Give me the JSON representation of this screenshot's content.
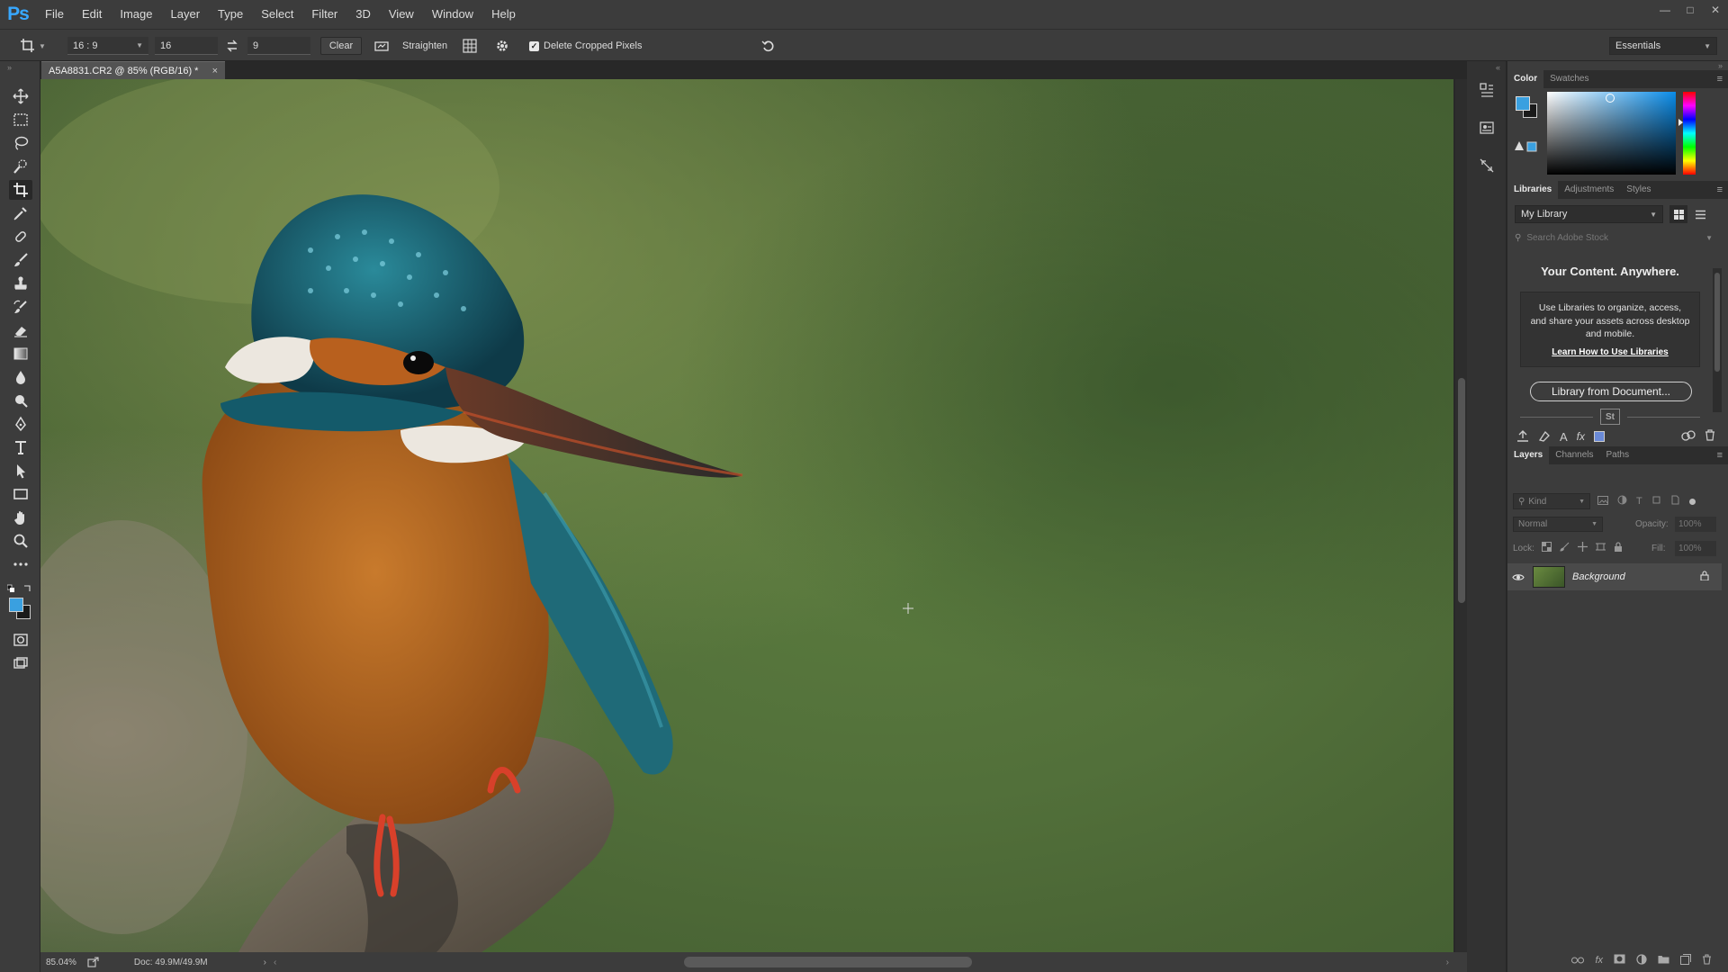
{
  "app": {
    "logo": "Ps"
  },
  "menu": [
    "File",
    "Edit",
    "Image",
    "Layer",
    "Type",
    "Select",
    "Filter",
    "3D",
    "View",
    "Window",
    "Help"
  ],
  "window_controls": [
    "minimize",
    "restore",
    "close"
  ],
  "options": {
    "ratio_preset": "16 : 9",
    "width_value": "16",
    "height_value": "9",
    "clear_label": "Clear",
    "straighten_label": "Straighten",
    "delete_cropped_label": "Delete Cropped Pixels",
    "delete_cropped_checked": true,
    "workspace": "Essentials"
  },
  "document": {
    "tab_title": "A5A8831.CR2 @ 85% (RGB/16) *",
    "zoom": "85.04%",
    "doc_size": "Doc: 49.9M/49.9M"
  },
  "color_panel": {
    "tabs": [
      "Color",
      "Swatches"
    ],
    "active_tab": "Color",
    "foreground": "#3aa0e0",
    "background": "#1a1a1a"
  },
  "libraries_panel": {
    "tabs": [
      "Libraries",
      "Adjustments",
      "Styles"
    ],
    "active_tab": "Libraries",
    "library": "My Library",
    "search_placeholder": "Search Adobe Stock",
    "heading": "Your Content. Anywhere.",
    "body": "Use Libraries to organize, access, and share your assets across desktop and mobile.",
    "link": "Learn How to Use Libraries",
    "button": "Library from Document...",
    "stock_badge": "St"
  },
  "layers_panel": {
    "tabs": [
      "Layers",
      "Channels",
      "Paths"
    ],
    "active_tab": "Layers",
    "filter_label": "Kind",
    "blend_mode": "Normal",
    "opacity_label": "Opacity:",
    "opacity_value": "100%",
    "lock_label": "Lock:",
    "fill_label": "Fill:",
    "fill_value": "100%",
    "layers": [
      {
        "name": "Background",
        "visible": true,
        "locked": true
      }
    ]
  }
}
